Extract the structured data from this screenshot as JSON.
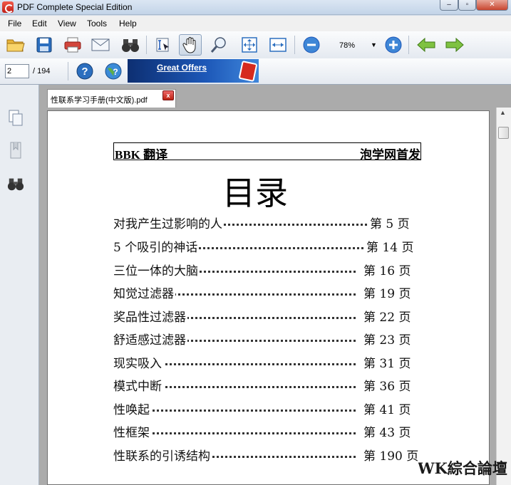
{
  "window": {
    "title": "PDF Complete Special Edition",
    "min": "–",
    "max": "▫",
    "close": "✕"
  },
  "menu": [
    "File",
    "Edit",
    "View",
    "Tools",
    "Help"
  ],
  "toolbar": {
    "page_current": "2",
    "page_total": "/ 194",
    "zoom": "78%",
    "offers_label": "Great Offers",
    "accent": "#1d58b8"
  },
  "tab": {
    "label": "性联系学习手册(中文版).pdf",
    "close": "x"
  },
  "document": {
    "header_left": "BBK 翻译",
    "header_right": "泡学网首发",
    "title": "目录",
    "toc": [
      {
        "title": "对我产生过影响的人",
        "page": "第 5 页"
      },
      {
        "title": "5 个吸引的神话",
        "page": "第 14 页"
      },
      {
        "title": "三位一体的大脑",
        "page": "第 16 页"
      },
      {
        "title": "知觉过滤器",
        "page": "第 19 页"
      },
      {
        "title": "奖品性过滤器",
        "page": "第 22 页"
      },
      {
        "title": "舒适感过滤器",
        "page": "第 23 页"
      },
      {
        "title": "现实吸入",
        "page": "第 31 页"
      },
      {
        "title": "模式中断",
        "page": "第 36 页"
      },
      {
        "title": "性唤起",
        "page": "第 41 页"
      },
      {
        "title": "性框架",
        "page": "第 43 页"
      },
      {
        "title": "性联系的引诱结构",
        "page": "第 190 页"
      }
    ]
  },
  "watermark": "WK綜合論壇"
}
